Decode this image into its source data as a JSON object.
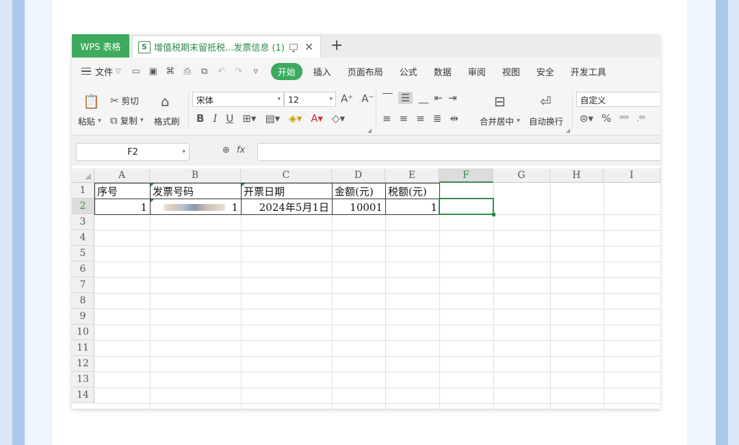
{
  "tabs": {
    "app_tab": "WPS 表格",
    "doc_tab": "增值税期末留抵税...发票信息 (1)",
    "doc_icon": "S",
    "close": "✕",
    "add": "+"
  },
  "menu": {
    "file_label": "文件",
    "tabs": [
      "开始",
      "插入",
      "页面布局",
      "公式",
      "数据",
      "审阅",
      "视图",
      "安全",
      "开发工具"
    ]
  },
  "ribbon": {
    "paste": "粘贴",
    "cut": "剪切",
    "copy": "复制",
    "format_painter": "格式刷",
    "font_name": "宋体",
    "font_size": "12",
    "merge_center": "合并居中",
    "wrap_text": "自动换行",
    "number_format": "自定义"
  },
  "formula_bar": {
    "name_box": "F2",
    "fx": "fx",
    "formula": ""
  },
  "columns": [
    "A",
    "B",
    "C",
    "D",
    "E",
    "F",
    "G",
    "H",
    "I"
  ],
  "active_column": "F",
  "rows": [
    "1",
    "2",
    "3",
    "4",
    "5",
    "6",
    "7",
    "8",
    "9",
    "10",
    "11",
    "12",
    "13",
    "14"
  ],
  "active_row": "2",
  "table": {
    "headers": [
      "序号",
      "发票号码",
      "开票日期",
      "金额(元)",
      "税额(元)"
    ],
    "row2": {
      "a": "1",
      "b_suffix": "1",
      "c": "2024年5月1日",
      "d": "10001",
      "e": "1"
    }
  },
  "colors": {
    "accent_green": "#3daa5d",
    "selection_green": "#2f8c46"
  }
}
